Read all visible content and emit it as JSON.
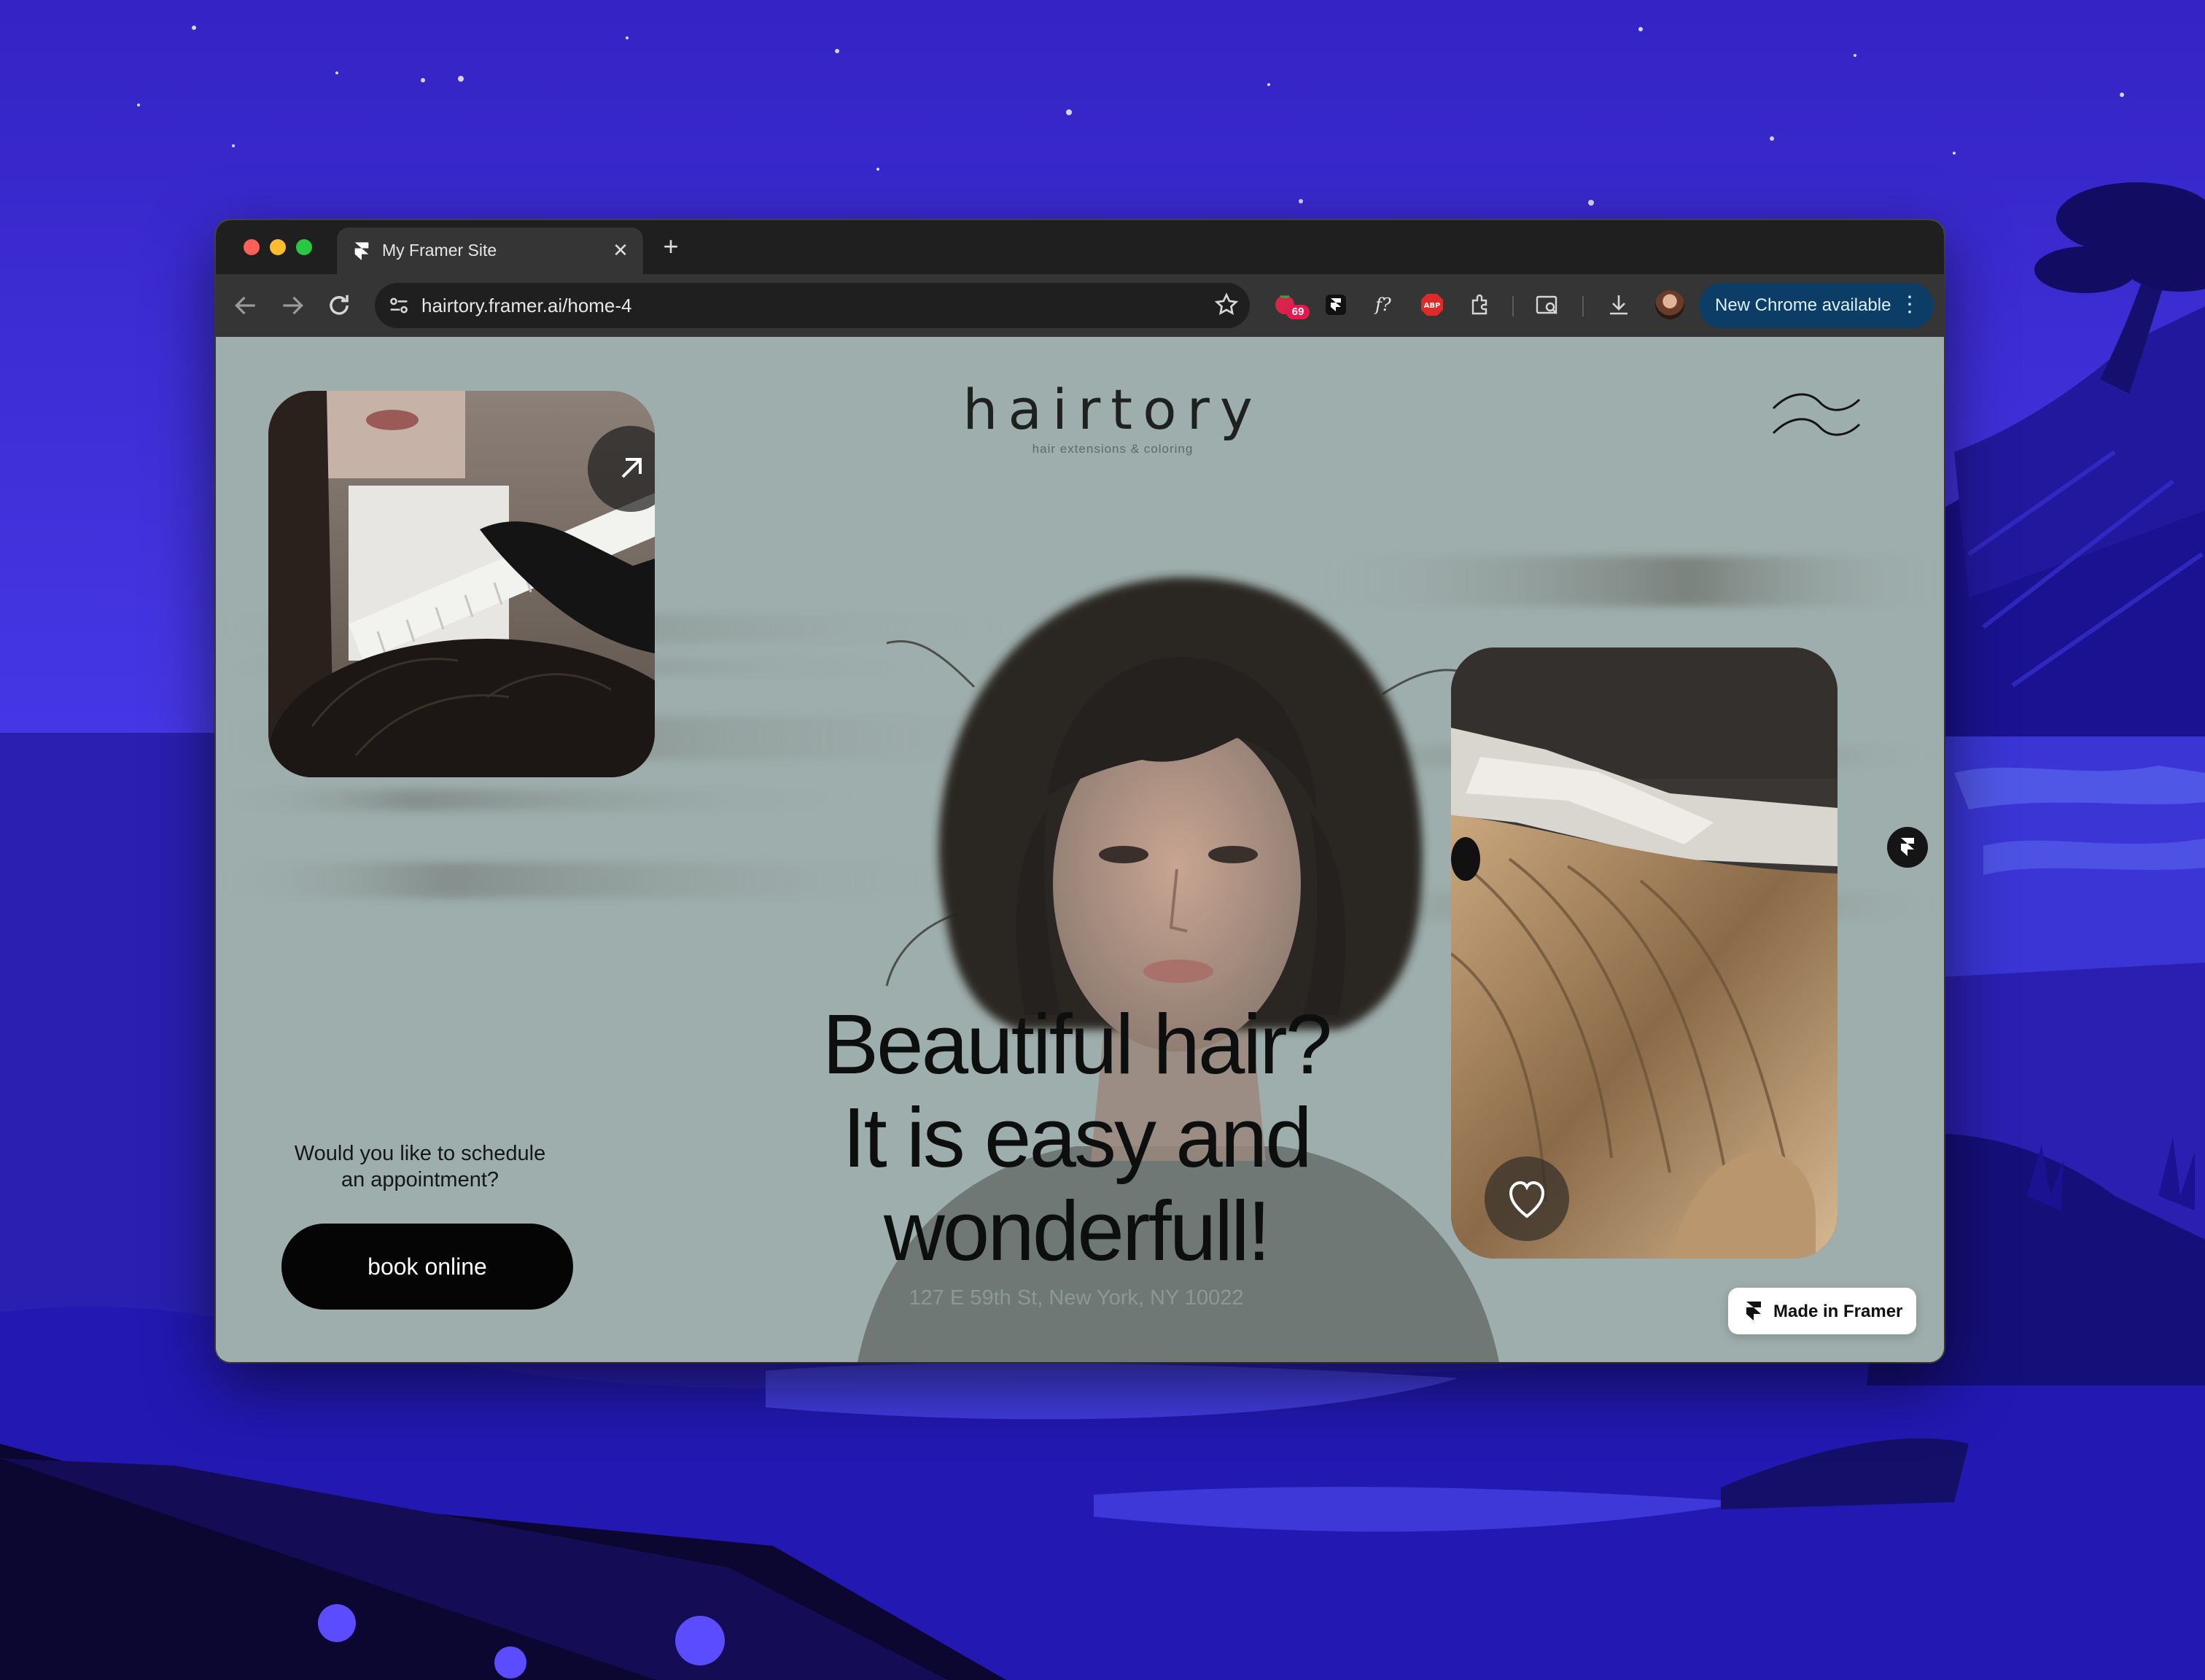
{
  "browser": {
    "tab_title": "My Framer Site",
    "close_glyph": "✕",
    "new_tab_glyph": "+",
    "url": "hairtory.framer.ai/home-4",
    "extension_badge": "69",
    "update_label": "New Chrome available",
    "menu_glyph": "⋮"
  },
  "site": {
    "logo": "hairtory",
    "tagline": "hair extensions & coloring",
    "headline_line1": "Beautiful hair?",
    "headline_line2": "It is easy and",
    "headline_line3": "wonderfull!",
    "address": "127 E 59th St, New York, NY 10022",
    "schedule_line1": "Would you like to schedule",
    "schedule_line2": "an appointment?",
    "book_label": "book online",
    "made_in_framer": "Made in Framer"
  },
  "colors": {
    "page_bg": "#9eaeac",
    "wallpaper": "#3a2bd6",
    "button": "#050505",
    "update_pill": "#0b3d66"
  },
  "icons": [
    "framer-icon",
    "arrow-up-right-icon",
    "heart-icon",
    "wave-menu-icon",
    "back-icon",
    "forward-icon",
    "reload-icon",
    "site-settings-icon",
    "star-icon",
    "download-icon",
    "extensions-icon"
  ]
}
